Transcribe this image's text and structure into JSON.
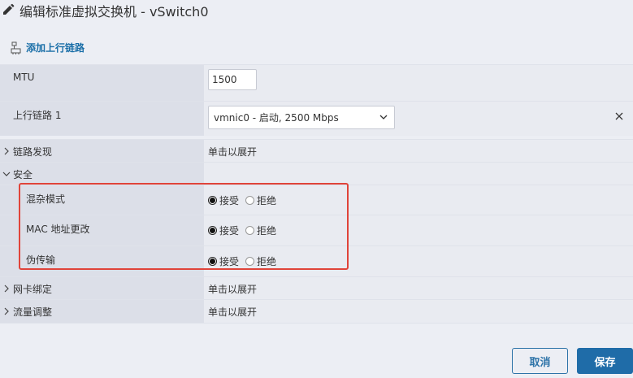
{
  "dialog": {
    "title": "编辑标准虚拟交换机 - vSwitch0"
  },
  "toolbar": {
    "add_uplink_label": "添加上行链路"
  },
  "form": {
    "mtu": {
      "label": "MTU",
      "value": "1500"
    },
    "uplink1": {
      "label": "上行链路 1",
      "selected": "vmnic0 - 启动, 2500 Mbps"
    },
    "link_discovery": {
      "label": "链路发现",
      "value": "单击以展开"
    },
    "security": {
      "label": "安全",
      "promiscuous": {
        "label": "混杂模式",
        "accept": "接受",
        "reject": "拒绝",
        "selected": "接受"
      },
      "mac_change": {
        "label": "MAC 地址更改",
        "accept": "接受",
        "reject": "拒绝",
        "selected": "接受"
      },
      "forged": {
        "label": "伪传输",
        "accept": "接受",
        "reject": "拒绝",
        "selected": "接受"
      }
    },
    "nic_teaming": {
      "label": "网卡绑定",
      "value": "单击以展开"
    },
    "traffic_shaping": {
      "label": "流量调整",
      "value": "单击以展开"
    }
  },
  "footer": {
    "cancel_label": "取消",
    "save_label": "保存"
  },
  "colors": {
    "accent": "#1f6ca8",
    "highlight": "#e0443a"
  }
}
